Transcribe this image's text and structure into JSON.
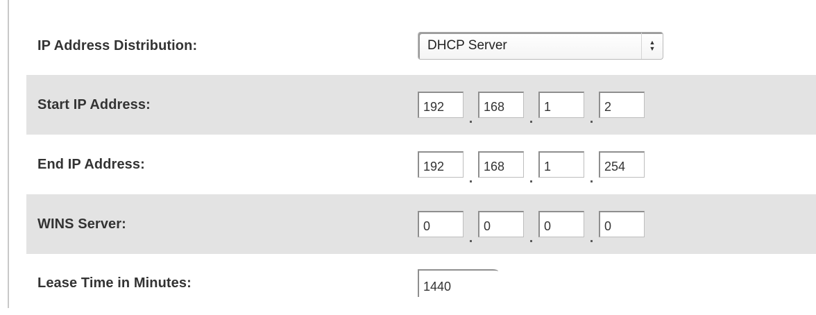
{
  "dhcp_settings": {
    "ip_distribution": {
      "label": "IP Address Distribution:",
      "selected": "DHCP Server",
      "arrows_icon": "updown-arrows-icon"
    },
    "start_ip": {
      "label": "Start IP Address:",
      "octets": [
        "192",
        "168",
        "1",
        "2"
      ]
    },
    "end_ip": {
      "label": "End IP Address:",
      "octets": [
        "192",
        "168",
        "1",
        "254"
      ]
    },
    "wins_server": {
      "label": "WINS Server:",
      "octets": [
        "0",
        "0",
        "0",
        "0"
      ]
    },
    "lease_time": {
      "label": "Lease Time in Minutes:",
      "value": "1440"
    },
    "octet_separator": "."
  },
  "colors": {
    "row_shaded_bg": "#e3e3e3",
    "label_text": "#333333",
    "field_border": "#8e8e8e"
  }
}
